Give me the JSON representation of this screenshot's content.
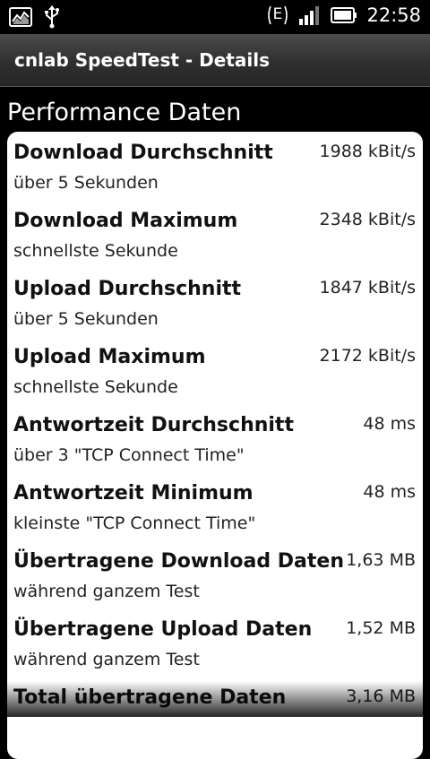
{
  "status_bar": {
    "time": "22:58",
    "network_type": "E",
    "icons": [
      "chart-notification-icon",
      "usb-icon",
      "network-e-icon",
      "signal-icon",
      "battery-icon"
    ]
  },
  "title_bar": {
    "title": "cnlab SpeedTest - Details"
  },
  "section": {
    "heading": "Performance Daten"
  },
  "rows": [
    {
      "label": "Download Durchschnitt",
      "value": "1988 kBit/s",
      "desc": "über 5 Sekunden"
    },
    {
      "label": "Download Maximum",
      "value": "2348 kBit/s",
      "desc": "schnellste Sekunde"
    },
    {
      "label": "Upload Durchschnitt",
      "value": "1847 kBit/s",
      "desc": "über 5 Sekunden"
    },
    {
      "label": "Upload Maximum",
      "value": "2172 kBit/s",
      "desc": "schnellste Sekunde"
    },
    {
      "label": "Antwortzeit Durchschnitt",
      "value": "48 ms",
      "desc": "über 3 \"TCP Connect Time\""
    },
    {
      "label": "Antwortzeit Minimum",
      "value": "48 ms",
      "desc": "kleinste \"TCP Connect Time\""
    },
    {
      "label": "Übertragene Download Daten",
      "value": "1,63 MB",
      "desc": "während ganzem Test"
    },
    {
      "label": "Übertragene Upload Daten",
      "value": "1,52 MB",
      "desc": "während ganzem Test"
    },
    {
      "label": "Total übertragene Daten",
      "value": "3,16 MB",
      "desc": ""
    }
  ],
  "colors": {
    "background": "#000000",
    "card": "#ffffff",
    "titlebar": "#3a3a3a"
  }
}
